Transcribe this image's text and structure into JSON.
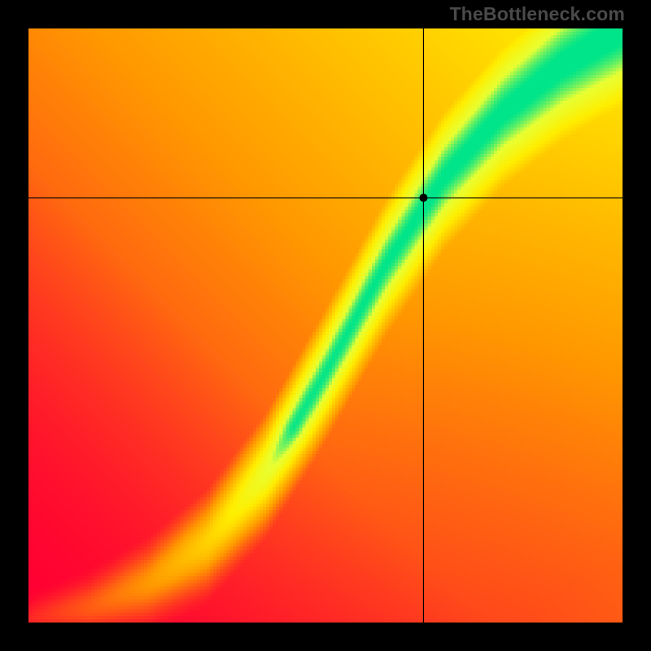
{
  "watermark": "TheBottleneck.com",
  "chart_data": {
    "type": "heatmap",
    "title": "",
    "xlabel": "",
    "ylabel": "",
    "xlim": [
      0,
      1
    ],
    "ylim": [
      0,
      1
    ],
    "colors": {
      "low": "#ff0033",
      "mid_warm": "#ff9900",
      "mid": "#ffee00",
      "mid_cool": "#e8ff33",
      "high": "#00e58a"
    },
    "optimal_curve": {
      "comment": "Approximate (x, y_optimal) pairs defining the green ridge; y measured from top (0) to bottom (1).",
      "x": [
        0.0,
        0.1,
        0.2,
        0.3,
        0.4,
        0.5,
        0.6,
        0.7,
        0.8,
        0.9,
        1.0
      ],
      "y": [
        1.0,
        0.98,
        0.94,
        0.87,
        0.75,
        0.58,
        0.4,
        0.25,
        0.14,
        0.06,
        0.0
      ]
    },
    "crosshair": {
      "x": 0.665,
      "y": 0.285
    },
    "marker": {
      "x": 0.665,
      "y": 0.285,
      "radius": 5,
      "color": "#000000"
    },
    "grid_resolution": 180
  }
}
